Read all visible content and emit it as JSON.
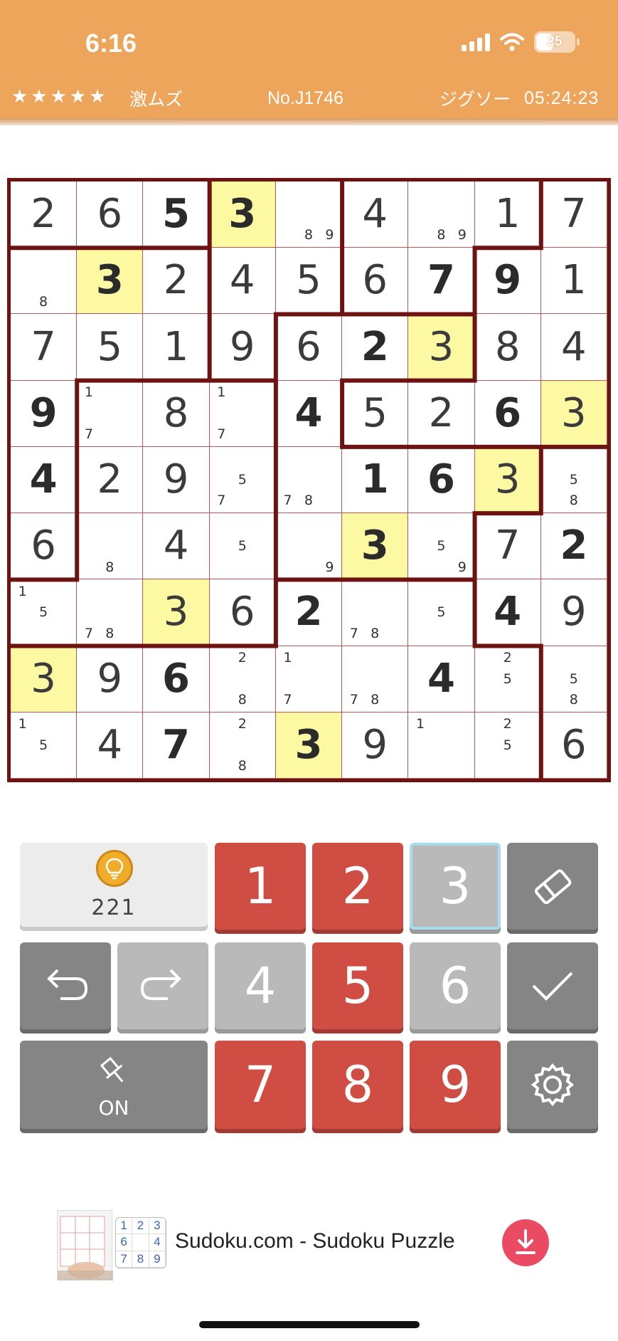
{
  "status_bar": {
    "time": "6:16",
    "battery": "25"
  },
  "info_bar": {
    "stars": "★★★★★",
    "difficulty": "激ムズ",
    "puzzle_no": "No.J1746",
    "mode": "ジグソー",
    "timer": "05:24:23"
  },
  "board": {
    "highlight_digit": "3",
    "rows": [
      [
        {
          "v": "2"
        },
        {
          "v": "6"
        },
        {
          "v": "5",
          "g": 1
        },
        {
          "v": "3",
          "g": 1
        },
        {
          "n": [
            8,
            9
          ]
        },
        {
          "v": "4"
        },
        {
          "n": [
            8,
            9
          ]
        },
        {
          "v": "1"
        },
        {
          "v": "7"
        }
      ],
      [
        {
          "n": [
            8
          ]
        },
        {
          "v": "3",
          "g": 1
        },
        {
          "v": "2"
        },
        {
          "v": "4"
        },
        {
          "v": "5"
        },
        {
          "v": "6"
        },
        {
          "v": "7",
          "g": 1
        },
        {
          "v": "9",
          "g": 1
        },
        {
          "v": "1"
        }
      ],
      [
        {
          "v": "7"
        },
        {
          "v": "5"
        },
        {
          "v": "1"
        },
        {
          "v": "9"
        },
        {
          "v": "6"
        },
        {
          "v": "2",
          "g": 1
        },
        {
          "v": "3"
        },
        {
          "v": "8"
        },
        {
          "v": "4"
        }
      ],
      [
        {
          "v": "9",
          "g": 1
        },
        {
          "n": [
            1,
            7
          ]
        },
        {
          "v": "8"
        },
        {
          "n": [
            1,
            7
          ]
        },
        {
          "v": "4",
          "g": 1
        },
        {
          "v": "5"
        },
        {
          "v": "2"
        },
        {
          "v": "6",
          "g": 1
        },
        {
          "v": "3"
        }
      ],
      [
        {
          "v": "4",
          "g": 1
        },
        {
          "v": "2"
        },
        {
          "v": "9"
        },
        {
          "n": [
            5,
            7
          ]
        },
        {
          "n": [
            7,
            8
          ]
        },
        {
          "v": "1",
          "g": 1
        },
        {
          "v": "6",
          "g": 1
        },
        {
          "v": "3"
        },
        {
          "n": [
            5,
            8
          ]
        }
      ],
      [
        {
          "v": "6"
        },
        {
          "n": [
            8
          ]
        },
        {
          "v": "4"
        },
        {
          "n": [
            5
          ]
        },
        {
          "n": [
            9
          ]
        },
        {
          "v": "3",
          "g": 1
        },
        {
          "n": [
            5,
            9
          ]
        },
        {
          "v": "7"
        },
        {
          "v": "2",
          "g": 1
        }
      ],
      [
        {
          "n": [
            1,
            5
          ]
        },
        {
          "n": [
            7,
            8
          ]
        },
        {
          "v": "3"
        },
        {
          "v": "6"
        },
        {
          "v": "2",
          "g": 1
        },
        {
          "n": [
            7,
            8
          ]
        },
        {
          "n": [
            5
          ]
        },
        {
          "v": "4",
          "g": 1
        },
        {
          "v": "9"
        }
      ],
      [
        {
          "v": "3"
        },
        {
          "v": "9"
        },
        {
          "v": "6",
          "g": 1
        },
        {
          "n": [
            2,
            8
          ]
        },
        {
          "n": [
            1,
            7
          ]
        },
        {
          "n": [
            7,
            8
          ]
        },
        {
          "v": "4",
          "g": 1
        },
        {
          "n": [
            2,
            5
          ]
        },
        {
          "n": [
            5,
            8
          ]
        }
      ],
      [
        {
          "n": [
            1,
            5
          ]
        },
        {
          "v": "4"
        },
        {
          "v": "7",
          "g": 1
        },
        {
          "n": [
            2,
            8
          ]
        },
        {
          "v": "3",
          "g": 1
        },
        {
          "v": "9"
        },
        {
          "n": [
            1
          ]
        },
        {
          "n": [
            2,
            5
          ]
        },
        {
          "v": "6"
        }
      ]
    ]
  },
  "keypad": {
    "hint_count": "221",
    "pin_label": "ON",
    "numbers": [
      "1",
      "2",
      "3",
      "4",
      "5",
      "6",
      "7",
      "8",
      "9"
    ],
    "selected_number": "3",
    "inactive_numbers": [
      "4",
      "6"
    ]
  },
  "ad": {
    "title": "Sudoku.com - Sudoku Puzzle",
    "grid_digits": [
      "1",
      "2",
      "3",
      "6",
      "",
      "4",
      "7",
      "8",
      "9"
    ]
  },
  "colors": {
    "header": "#eca55a",
    "border": "#6e1212",
    "highlight": "#fdf9a3",
    "key_red": "#cf4d42",
    "key_grey": "#b9b9b9",
    "key_dark": "#858585",
    "download": "#ea4a62"
  }
}
